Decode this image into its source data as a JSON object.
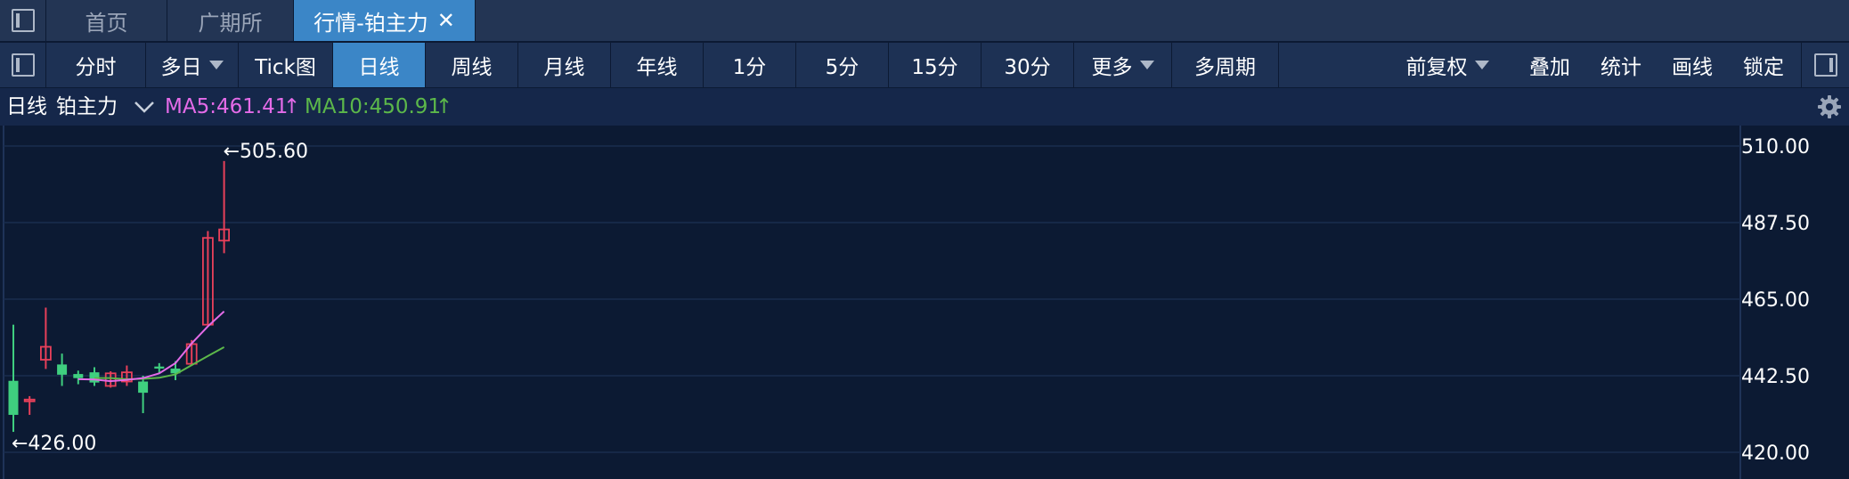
{
  "tabs": {
    "home": "首页",
    "gfex": "广期所",
    "quote": "行情-铂主力",
    "close_glyph": "✕"
  },
  "toolbar": {
    "items": [
      "分时",
      "多日",
      "Tick图",
      "日线",
      "周线",
      "月线",
      "年线",
      "1分",
      "5分",
      "15分",
      "30分",
      "更多",
      "多周期"
    ],
    "active": "日线",
    "right": [
      "前复权",
      "叠加",
      "统计",
      "画线",
      "锁定"
    ]
  },
  "infobar": {
    "period": "日线",
    "symbol": "铂主力",
    "ma5": "MA5:461.41",
    "ma10": "MA10:450.91",
    "arrow": "↑"
  },
  "colors": {
    "up": "#e8405a",
    "down": "#3fcf7f",
    "ma5": "#e46be8",
    "ma10": "#5cb84a",
    "accent": "#3b86c7"
  },
  "chart_data": {
    "type": "candlestick",
    "y_ticks": [
      "510.00",
      "487.50",
      "465.00",
      "442.50",
      "420.00"
    ],
    "ylim": [
      420,
      510
    ],
    "max_label": "←505.60",
    "min_label": "←426.00",
    "candles": [
      {
        "o": 441,
        "h": 457.5,
        "l": 426,
        "c": 431
      },
      {
        "o": 435.5,
        "h": 436.5,
        "l": 431,
        "c": 435.5
      },
      {
        "o": 447.2,
        "h": 462.5,
        "l": 444.5,
        "c": 451
      },
      {
        "o": 445.8,
        "h": 449,
        "l": 439.5,
        "c": 442.8
      },
      {
        "o": 443,
        "h": 444,
        "l": 440,
        "c": 441.8
      },
      {
        "o": 443.5,
        "h": 445,
        "l": 439.5,
        "c": 440.5
      },
      {
        "o": 439.5,
        "h": 443.8,
        "l": 439,
        "c": 443.2
      },
      {
        "o": 440.8,
        "h": 445.5,
        "l": 439.5,
        "c": 443.5
      },
      {
        "o": 440.8,
        "h": 442.5,
        "l": 431.5,
        "c": 437.5
      },
      {
        "o": 445.2,
        "h": 446.2,
        "l": 443.2,
        "c": 444.6
      },
      {
        "o": 444.6,
        "h": 446.8,
        "l": 441.2,
        "c": 443.2
      },
      {
        "o": 446,
        "h": 453,
        "l": 446,
        "c": 451.8
      },
      {
        "o": 457.5,
        "h": 485,
        "l": 457.5,
        "c": 483
      },
      {
        "o": 482.2,
        "h": 505.6,
        "l": 478.5,
        "c": 485.5
      }
    ],
    "ma5": [
      null,
      null,
      null,
      null,
      441.5,
      441.4,
      440.9,
      441.3,
      441.8,
      443.2,
      446.2,
      452.0,
      457.0,
      461.41
    ],
    "ma10": [
      null,
      null,
      null,
      null,
      null,
      441.8,
      441.8,
      441.5,
      441.6,
      441.9,
      442.9,
      445.6,
      448.3,
      450.91
    ]
  }
}
